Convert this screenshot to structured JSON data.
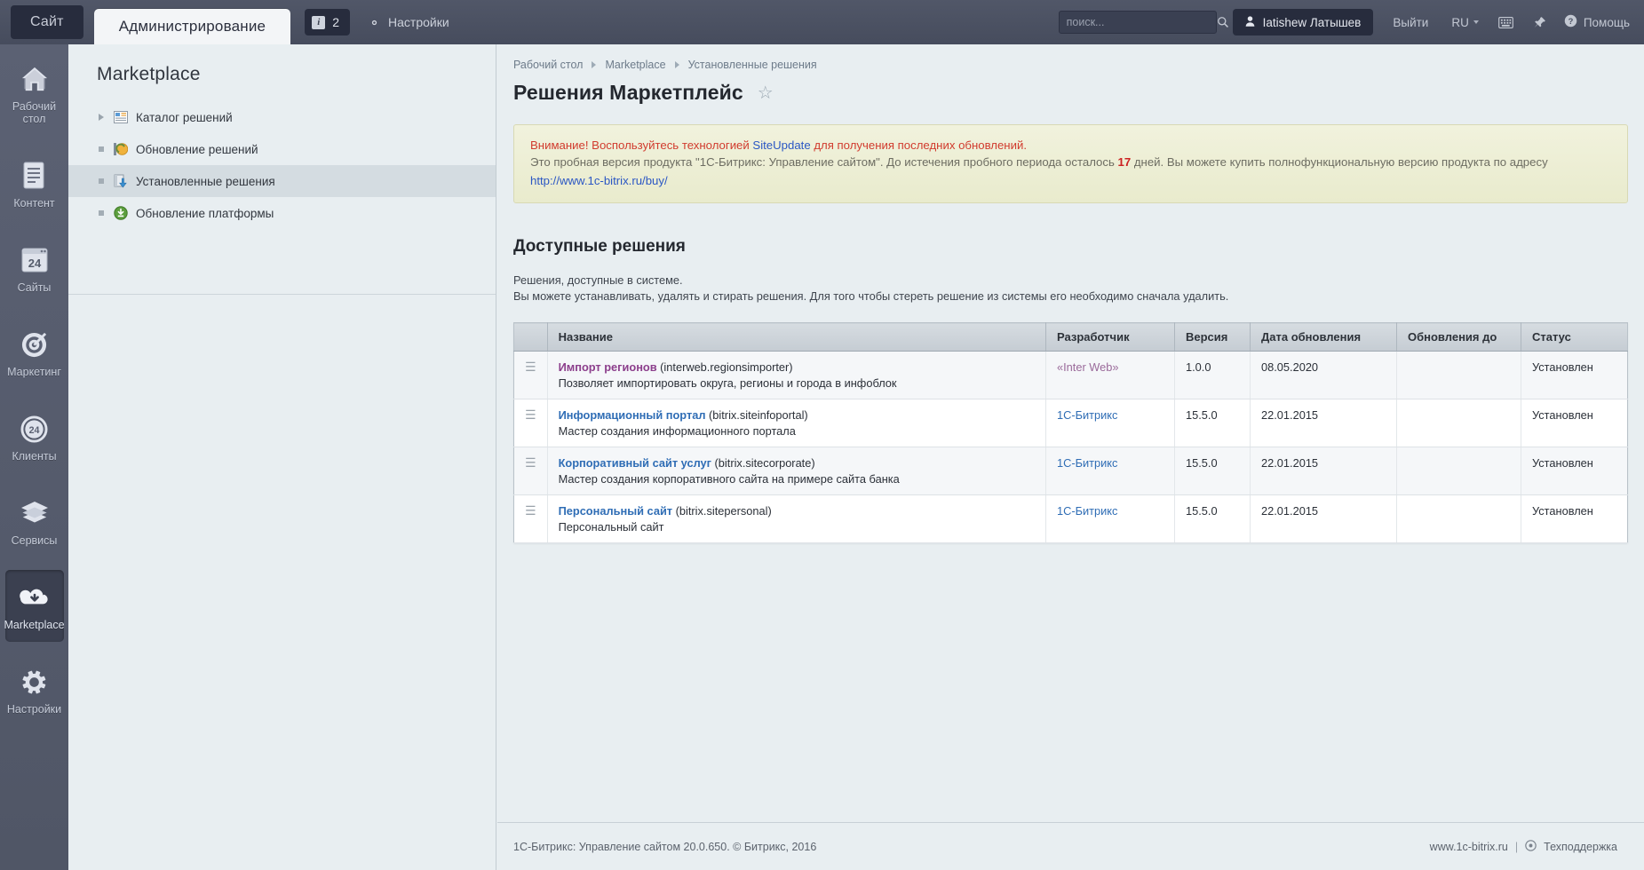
{
  "topbar": {
    "site_tab": "Сайт",
    "admin_tab": "Администрирование",
    "notifications_count": "2",
    "notifications_icon": "info-icon",
    "settings_label": "Настройки",
    "settings_icon": "gear-icon",
    "search_placeholder": "поиск...",
    "search_value": "",
    "search_icon": "search-icon",
    "user_name": "Iatishew Латышев",
    "user_icon": "user-icon",
    "logout_label": "Выйти",
    "language": "RU",
    "keyboard_icon": "keyboard-icon",
    "pin_icon": "pin-icon",
    "help_label": "Помощь",
    "help_icon": "question-circle-icon"
  },
  "rail": {
    "items": [
      {
        "label": "Рабочий стол",
        "icon": "home-icon",
        "active": false
      },
      {
        "label": "Контент",
        "icon": "document-icon",
        "active": false
      },
      {
        "label": "Сайты",
        "icon": "browser-24-icon",
        "active": false
      },
      {
        "label": "Маркетинг",
        "icon": "target-icon",
        "active": false
      },
      {
        "label": "Клиенты",
        "icon": "circle-24-icon",
        "active": false
      },
      {
        "label": "Сервисы",
        "icon": "layers-icon",
        "active": false
      },
      {
        "label": "Marketplace",
        "icon": "cloud-download-icon",
        "active": true
      },
      {
        "label": "Настройки",
        "icon": "gear-icon",
        "active": false
      }
    ]
  },
  "menu": {
    "title": "Marketplace",
    "items": [
      {
        "label": "Каталог решений",
        "icon": "catalog-icon",
        "marker": "arrow",
        "selected": false
      },
      {
        "label": "Обновление решений",
        "icon": "update-solutions-icon",
        "marker": "dot",
        "selected": false
      },
      {
        "label": "Установленные решения",
        "icon": "installed-solutions-icon",
        "marker": "dot",
        "selected": true
      },
      {
        "label": "Обновление платформы",
        "icon": "update-platform-icon",
        "marker": "dot",
        "selected": false
      }
    ]
  },
  "breadcrumb": [
    {
      "label": "Рабочий стол"
    },
    {
      "label": "Marketplace"
    },
    {
      "label": "Установленные решения"
    }
  ],
  "page": {
    "title": "Решения Маркетплейс",
    "favorite_icon": "star-outline-icon"
  },
  "notice": {
    "line1_pre": "Внимание! Воспользуйтесь технологией ",
    "line1_link": "SiteUpdate",
    "line1_post": " для получения последних обновлений.",
    "line2_pre": "Это пробная версия продукта \"1С-Битрикс: Управление сайтом\". До истечения пробного периода осталось ",
    "line2_count": "17",
    "line2_post": " дней. Вы можете купить полнофункциональную версию продукта по адресу",
    "line3_link": "http://www.1c-bitrix.ru/buy/"
  },
  "section": {
    "title": "Доступные решения",
    "desc_line1": "Решения, доступные в системе.",
    "desc_line2": "Вы можете устанавливать, удалять и стирать решения. Для того чтобы стереть решение из системы его необходимо сначала удалить."
  },
  "table": {
    "columns": [
      "",
      "Название",
      "Разработчик",
      "Версия",
      "Дата обновления",
      "Обновления до",
      "Статус"
    ],
    "drag_icon": "drag-handle-icon",
    "rows": [
      {
        "name": "Импорт регионов",
        "code": "(interweb.regionsimporter)",
        "desc": "Позволяет импортировать округа, регионы и города в инфоблок",
        "developer": "«Inter Web»",
        "developer_style": "purple",
        "name_style": "purple",
        "version": "1.0.0",
        "updated": "08.05.2020",
        "updates_until": "",
        "status": "Установлен"
      },
      {
        "name": "Информационный портал",
        "code": "(bitrix.siteinfoportal)",
        "desc": "Мастер создания информационного портала",
        "developer": "1С-Битрикс",
        "developer_style": "blue",
        "name_style": "blue",
        "version": "15.5.0",
        "updated": "22.01.2015",
        "updates_until": "",
        "status": "Установлен"
      },
      {
        "name": "Корпоративный сайт услуг",
        "code": "(bitrix.sitecorporate)",
        "desc": "Мастер создания корпоративного сайта на примере сайта банка",
        "developer": "1С-Битрикс",
        "developer_style": "blue",
        "name_style": "blue",
        "version": "15.5.0",
        "updated": "22.01.2015",
        "updates_until": "",
        "status": "Установлен"
      },
      {
        "name": "Персональный сайт",
        "code": "(bitrix.sitepersonal)",
        "desc": "Персональный сайт",
        "developer": "1С-Битрикс",
        "developer_style": "blue",
        "name_style": "blue",
        "version": "15.5.0",
        "updated": "22.01.2015",
        "updates_until": "",
        "status": "Установлен"
      }
    ]
  },
  "footer": {
    "copyright": "1С-Битрикс: Управление сайтом 20.0.650. © Битрикс, 2016",
    "site_link": "www.1c-bitrix.ru",
    "separator": "|",
    "support_label": "Техподдержка",
    "support_icon": "gear-icon"
  }
}
